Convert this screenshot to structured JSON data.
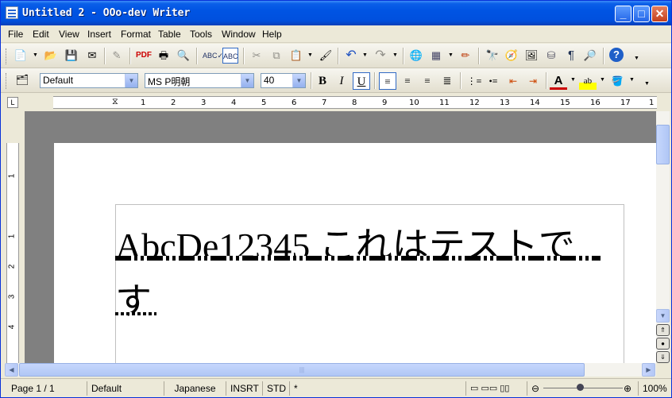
{
  "window": {
    "title": "Untitled 2 - OOo-dev Writer",
    "controls": {
      "minimize": "_",
      "maximize": "□",
      "close": "✕"
    }
  },
  "menu": [
    "File",
    "Edit",
    "View",
    "Insert",
    "Format",
    "Table",
    "Tools",
    "Window",
    "Help"
  ],
  "toolbar_standard": {
    "icons": [
      "new-icon",
      "open-icon",
      "save-icon",
      "email-icon",
      "edit-file-icon",
      "export-pdf-icon",
      "print-icon",
      "page-preview-icon",
      "spellcheck-icon",
      "autospellcheck-icon",
      "cut-icon",
      "copy-icon",
      "paste-icon",
      "clone-format-icon",
      "undo-icon",
      "redo-icon",
      "hyperlink-icon",
      "table-icon",
      "draw-functions-icon",
      "find-icon",
      "navigator-icon",
      "gallery-icon",
      "data-sources-icon",
      "nonprinting-chars-icon",
      "zoom-icon",
      "help-icon"
    ]
  },
  "toolbar_format": {
    "style": "Default",
    "font": "MS P明朝",
    "size": "40",
    "bold": "B",
    "italic": "I",
    "underline": "U",
    "underline_active": true
  },
  "ruler": {
    "h_ticks": [
      "1",
      "2",
      "3",
      "4",
      "5",
      "6",
      "7",
      "8",
      "9",
      "10",
      "11",
      "12",
      "13",
      "14",
      "15",
      "16",
      "17",
      "1"
    ],
    "v_ticks": [
      "1",
      "1",
      "2",
      "3",
      "4"
    ]
  },
  "document": {
    "line1": "AbcDe12345 これはテストで",
    "line2": "す"
  },
  "status": {
    "page": "Page 1 / 1",
    "style": "Default",
    "language": "Japanese",
    "insert_mode": "INSRT",
    "selection_mode": "STD",
    "modified": "*",
    "zoom": "100%"
  },
  "colors": {
    "titlebar": "#0054e3",
    "chrome": "#ece9d8",
    "doc_background": "#808080",
    "scroll_accent": "#b0c6f5"
  }
}
